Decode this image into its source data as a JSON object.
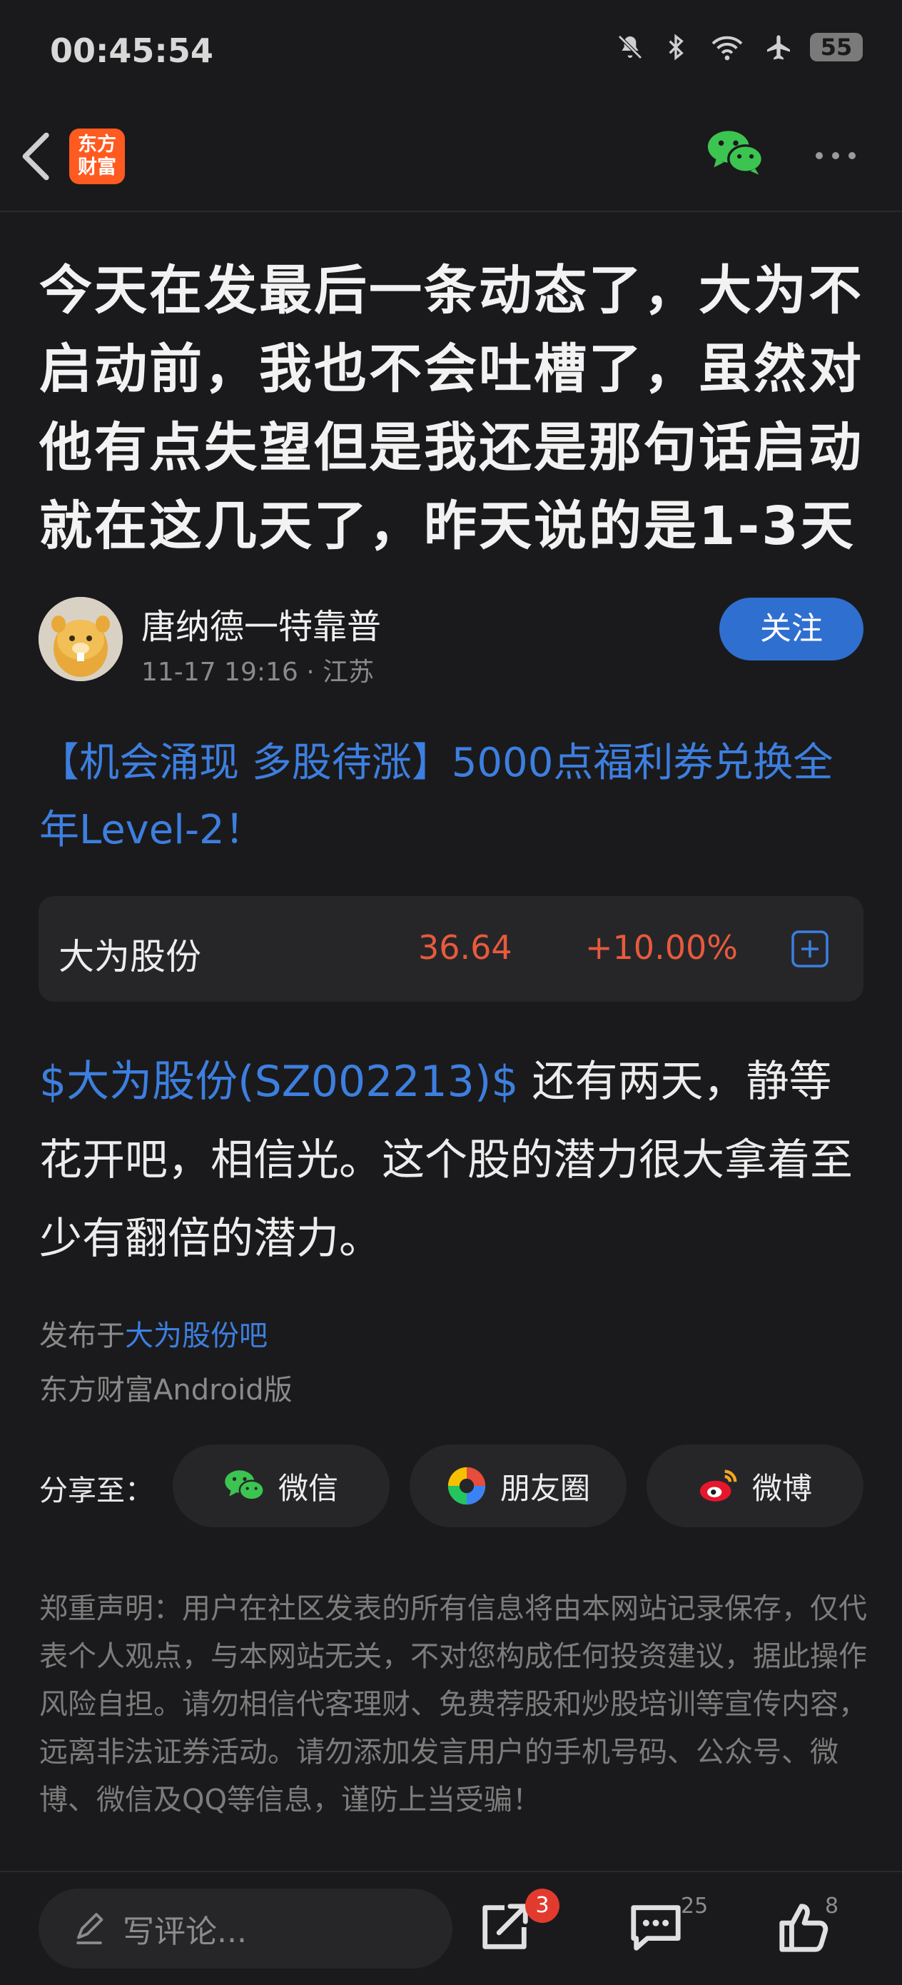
{
  "status_bar": {
    "time": "00:45:54",
    "battery": "55"
  },
  "nav": {
    "app_logo_line1": "东方",
    "app_logo_line2": "财富"
  },
  "post": {
    "title": "今天在发最后一条动态了，大为不启动前，我也不会吐槽了，虽然对他有点失望但是我还是那句话启动就在这几天了，昨天说的是1-3天",
    "author": {
      "name": "唐纳德一特靠普",
      "datetime": "11-17 19:16",
      "location": "· 江苏",
      "follow_label": "关注"
    },
    "promo": "【机会涌现 多股待涨】5000点福利券兑换全年Level-2！",
    "stock": {
      "name": "大为股份",
      "price": "36.64",
      "change": "+10.00%"
    },
    "body": {
      "stock_tag": "$大为股份(SZ002213)$",
      "text": " 还有两天，静等花开吧，相信光。这个股的潜力很大拿着至少有翻倍的潜力。"
    },
    "posted_prefix": "发布于",
    "posted_forum": "大为股份吧",
    "client": "东方财富Android版"
  },
  "share": {
    "label": "分享至：",
    "buttons": [
      {
        "label": "微信",
        "icon": "wechat-icon"
      },
      {
        "label": "朋友圈",
        "icon": "moments-icon"
      },
      {
        "label": "微博",
        "icon": "weibo-icon"
      }
    ]
  },
  "disclaimer": "郑重声明：用户在社区发表的所有信息将由本网站记录保存，仅代表个人观点，与本网站无关，不对您构成任何投资建议，据此操作风险自担。请勿相信代客理财、免费荐股和炒股培训等宣传内容，远离非法证券活动。请勿添加发言用户的手机号码、公众号、微博、微信及QQ等信息，谨防上当受骗！",
  "bottom_bar": {
    "comment_placeholder": "写评论...",
    "share_count": "3",
    "comment_count": "25",
    "like_count": "8"
  },
  "colors": {
    "accent_blue": "#3d7fe0",
    "up_red": "#e85a3c",
    "brand_orange": "#ff5a1f",
    "wechat_green": "#3cc451"
  }
}
